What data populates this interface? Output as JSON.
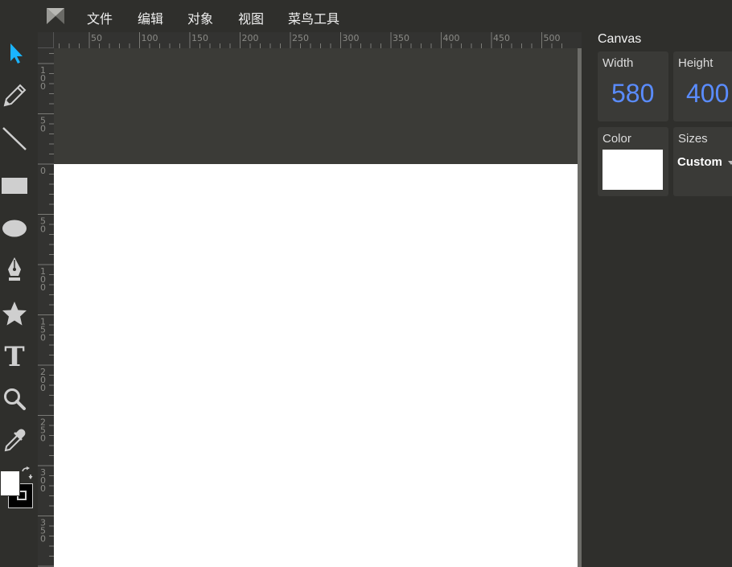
{
  "menu": {
    "items": [
      "文件",
      "编辑",
      "对象",
      "视图",
      "菜鸟工具"
    ]
  },
  "tools": [
    {
      "name": "select-tool",
      "icon": "pointer-arrow-icon"
    },
    {
      "name": "pencil-tool",
      "icon": "pencil-icon"
    },
    {
      "name": "line-tool",
      "icon": "line-icon"
    },
    {
      "name": "rectangle-tool",
      "icon": "rectangle-icon"
    },
    {
      "name": "ellipse-tool",
      "icon": "ellipse-icon"
    },
    {
      "name": "pen-tool",
      "icon": "pen-nib-icon"
    },
    {
      "name": "star-tool",
      "icon": "star-icon"
    },
    {
      "name": "text-tool",
      "icon": "text-t-icon"
    },
    {
      "name": "zoom-tool",
      "icon": "magnifier-icon"
    },
    {
      "name": "eyedropper-tool",
      "icon": "eyedropper-icon"
    }
  ],
  "colors": {
    "accent": "#1ab4ff",
    "fill": "#ffffff",
    "stroke": "#000000",
    "value_text": "#5a8cff",
    "canvas_color": "#ffffff"
  },
  "rulers": {
    "top_labels": [
      "50",
      "100",
      "150",
      "200",
      "250",
      "300",
      "350",
      "400",
      "450",
      "500"
    ],
    "left_labels": [
      "100",
      "50",
      "0",
      "50",
      "100",
      "150",
      "200",
      "250",
      "300",
      "350"
    ]
  },
  "panel": {
    "title": "Canvas",
    "width_label": "Width",
    "width_value": "580",
    "height_label": "Height",
    "height_value": "400",
    "color_label": "Color",
    "sizes_label": "Sizes",
    "sizes_value": "Custom"
  }
}
